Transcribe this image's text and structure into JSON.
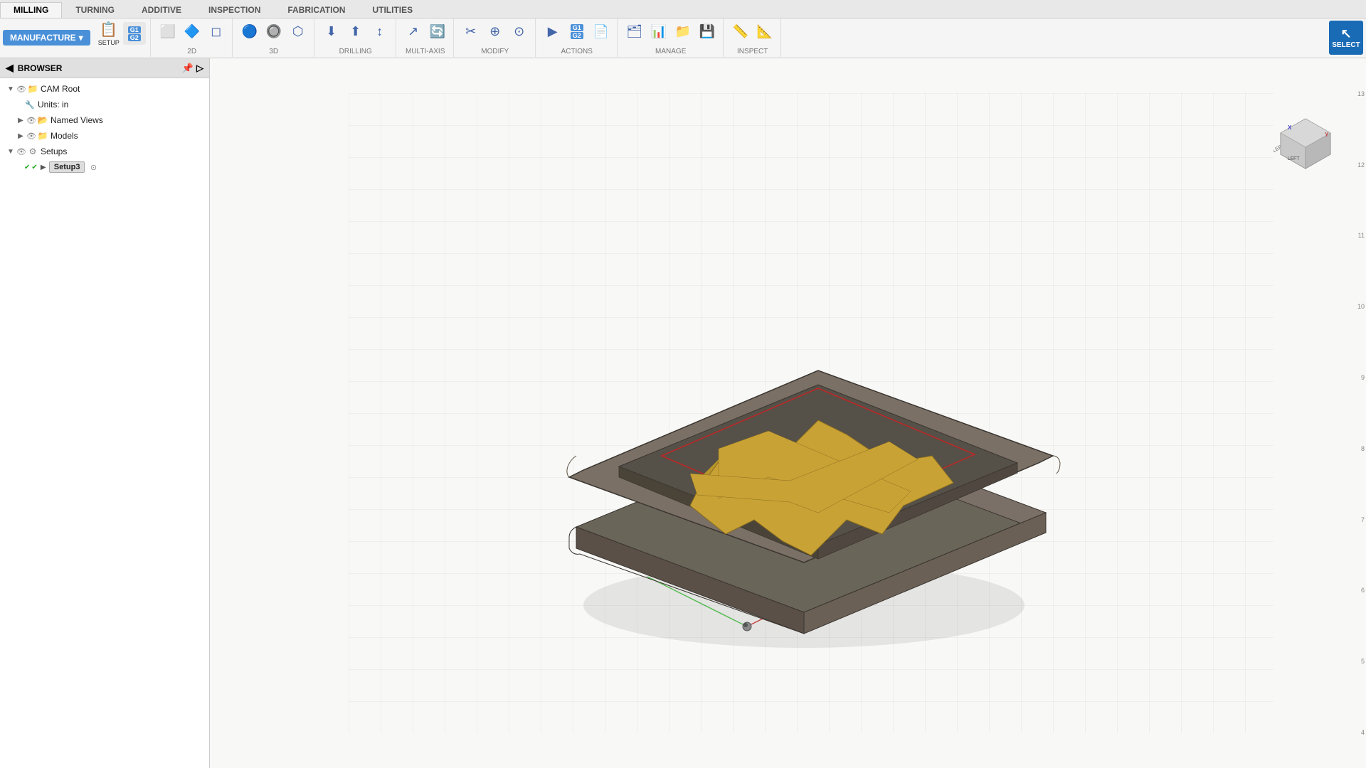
{
  "tabs": [
    {
      "label": "MILLING",
      "active": true
    },
    {
      "label": "TURNING",
      "active": false
    },
    {
      "label": "ADDITIVE",
      "active": false
    },
    {
      "label": "INSPECTION",
      "active": false
    },
    {
      "label": "FABRICATION",
      "active": false
    },
    {
      "label": "UTILITIES",
      "active": false
    }
  ],
  "manufacture_label": "MANUFACTURE",
  "ribbon": {
    "setup_label": "SETUP",
    "2d_label": "2D",
    "3d_label": "3D",
    "drilling_label": "DRILLING",
    "multi_axis_label": "MULTI-AXIS",
    "modify_label": "MODIFY",
    "actions_label": "ACTIONS",
    "manage_label": "MANAGE",
    "inspect_label": "INSPECT",
    "select_label": "SELECT"
  },
  "browser": {
    "title": "BROWSER",
    "tree": {
      "cam_root": "CAM Root",
      "units": "Units: in",
      "named_views": "Named Views",
      "models": "Models",
      "setups": "Setups",
      "setup3": "Setup3"
    }
  },
  "viewport": {
    "ruler_marks": [
      "13",
      "12",
      "11",
      "10",
      "9",
      "8",
      "7",
      "6",
      "5",
      "4"
    ]
  }
}
